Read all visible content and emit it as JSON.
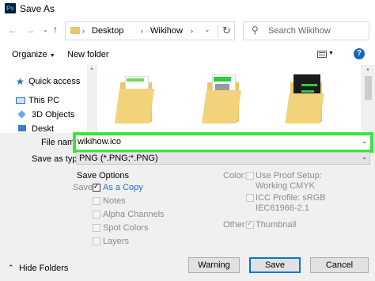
{
  "window": {
    "title": "Save As",
    "app_icon": "photoshop-icon",
    "app_icon_text": "Ps"
  },
  "address": {
    "breadcrumbs": [
      "Desktop",
      "Wikihow"
    ],
    "search_placeholder": "Search Wikihow"
  },
  "toolbar": {
    "organize_label": "Organize",
    "new_folder_label": "New folder"
  },
  "sidebar": {
    "items": [
      {
        "label": "Quick access",
        "icon": "star-icon"
      },
      {
        "label": "This PC",
        "icon": "computer-icon"
      },
      {
        "label": "3D Objects",
        "icon": "cube-icon"
      },
      {
        "label": "Deskt",
        "icon": "desktop-icon"
      }
    ]
  },
  "form": {
    "file_name_label": "File name:",
    "file_name_value": "wikihow.ico",
    "save_as_type_label": "Save as type:",
    "save_as_type_value": "PNG (*.PNG;*.PNG)"
  },
  "options": {
    "heading": "Save Options",
    "save_label": "Save:",
    "as_a_copy_label": "As a Copy",
    "notes_label": "Notes",
    "alpha_channels_label": "Alpha Channels",
    "spot_colors_label": "Spot Colors",
    "layers_label": "Layers",
    "color_label": "Color:",
    "use_proof_label": "Use Proof Setup:",
    "use_proof_sub": "Working CMYK",
    "icc_label": "ICC Profile:  sRGB",
    "icc_sub": "IEC61966-2.1",
    "other_label": "Other:",
    "thumbnail_label": "Thumbnail"
  },
  "footer": {
    "hide_folders_label": "Hide Folders",
    "warning_label": "Warning",
    "save_label": "Save",
    "cancel_label": "Cancel"
  },
  "colors": {
    "highlight": "#39e639",
    "accent": "#0078d7"
  }
}
